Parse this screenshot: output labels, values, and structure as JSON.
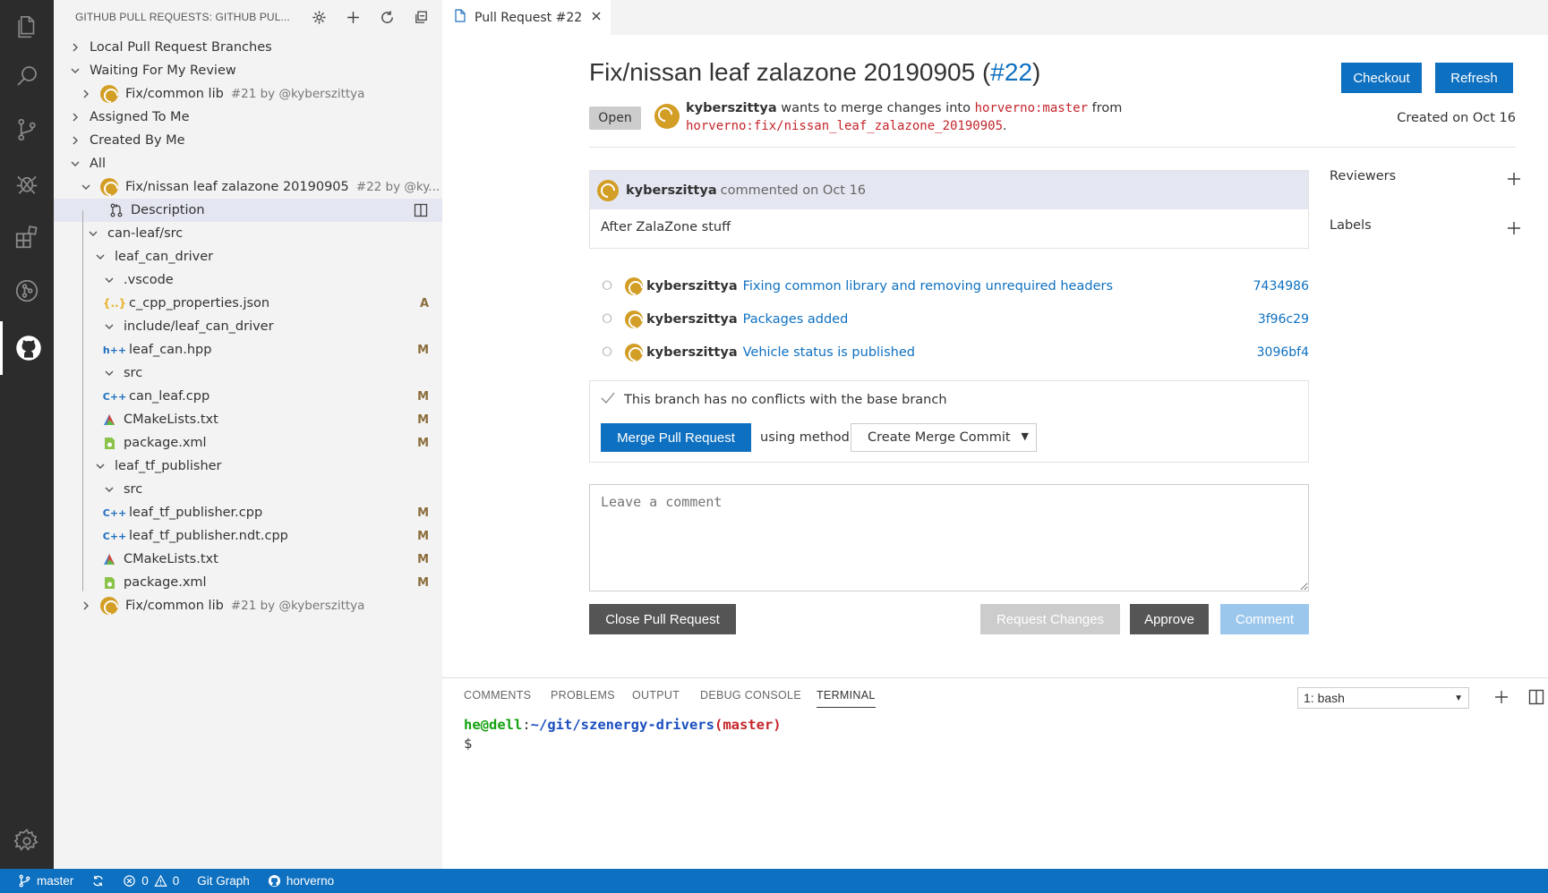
{
  "activity_bar": {
    "items": [
      "explorer-icon",
      "search-icon",
      "source-control-icon",
      "debug-icon",
      "extensions-icon",
      "git-graph-icon",
      "github-icon"
    ],
    "settings": "gear-icon"
  },
  "sidebar": {
    "title": "GITHUB PULL REQUESTS: GITHUB PUL...",
    "tree": [
      {
        "label": "Local Pull Request Branches"
      },
      {
        "label": "Waiting For My Review"
      },
      {
        "label": "Fix/common lib",
        "meta": "#21 by @kyberszittya"
      },
      {
        "label": "Assigned To Me"
      },
      {
        "label": "Created By Me"
      },
      {
        "label": "All"
      },
      {
        "label": "Fix/nissan leaf zalazone 20190905",
        "meta": "#22 by @ky..."
      },
      {
        "label": "Description"
      },
      {
        "label": "can-leaf/src"
      },
      {
        "label": "leaf_can_driver"
      },
      {
        "label": ".vscode"
      },
      {
        "label": "c_cpp_properties.json",
        "badge": "A",
        "icon_text": "{..}"
      },
      {
        "label": "include/leaf_can_driver"
      },
      {
        "label": "leaf_can.hpp",
        "badge": "M",
        "icon_text": "h++"
      },
      {
        "label": "src"
      },
      {
        "label": "can_leaf.cpp",
        "badge": "M",
        "icon_text": "C++"
      },
      {
        "label": "CMakeLists.txt",
        "badge": "M"
      },
      {
        "label": "package.xml",
        "badge": "M"
      },
      {
        "label": "leaf_tf_publisher"
      },
      {
        "label": "src"
      },
      {
        "label": "leaf_tf_publisher.cpp",
        "badge": "M",
        "icon_text": "C++"
      },
      {
        "label": "leaf_tf_publisher.ndt.cpp",
        "badge": "M",
        "icon_text": "C++"
      },
      {
        "label": "CMakeLists.txt",
        "badge": "M"
      },
      {
        "label": "package.xml",
        "badge": "M"
      },
      {
        "label": "Fix/common lib",
        "meta": "#21 by @kyberszittya"
      }
    ]
  },
  "editor": {
    "tab_label": "Pull Request #22",
    "title": "Fix/nissan leaf zalazone 20190905 (",
    "number": "#22",
    "title_end": ")",
    "checkout_label": "Checkout",
    "refresh_label": "Refresh",
    "state": "Open",
    "author": "kyberszittya",
    "merge_text_1": "wants to merge changes  into",
    "base_branch": "horverno:master",
    "merge_text_2": "from",
    "head_branch": "horverno:fix/nissan_leaf_zalazone_20190905",
    "period": ".",
    "created": "Created  on Oct 16",
    "comment": {
      "author": "kyberszittya",
      "action": "commented on Oct 16",
      "body": "After ZalaZone stuff"
    },
    "commits": [
      {
        "author": "kyberszittya",
        "message": "Fixing common library and removing unrequired headers",
        "sha": "7434986"
      },
      {
        "author": "kyberszittya",
        "message": "Packages added",
        "sha": "3f96c29"
      },
      {
        "author": "kyberszittya",
        "message": "Vehicle status is published",
        "sha": "3096bf4"
      }
    ],
    "merge_status": "This branch has no conflicts with the base branch",
    "merge_button": "Merge Pull Request",
    "using_method": "using method",
    "method": "Create Merge Commit",
    "comment_placeholder": "Leave a comment",
    "close_button": "Close Pull Request",
    "request_changes_button": "Request Changes",
    "approve_button": "Approve",
    "comment_button": "Comment",
    "reviewers_label": "Reviewers",
    "labels_label": "Labels"
  },
  "panel": {
    "tabs": [
      "COMMENTS",
      "PROBLEMS",
      "OUTPUT",
      "DEBUG CONSOLE",
      "TERMINAL"
    ],
    "active_tab": "TERMINAL",
    "terminal_select": "1: bash",
    "prompt_user": "he@dell",
    "prompt_colon": ":",
    "prompt_path": "~/git/szenergy-drivers",
    "prompt_branch": "(master)",
    "prompt_symbol": "$"
  },
  "status_bar": {
    "branch": "master",
    "errors": "0",
    "warnings": "0",
    "git_graph": "Git Graph",
    "account": "horverno"
  },
  "colors": {
    "accent": "#0e70c0",
    "status_bar": "#0e70c0",
    "activity_bar": "#2c2c2c",
    "sidebar": "#f3f3f3",
    "branch_text": "#c5252b"
  }
}
